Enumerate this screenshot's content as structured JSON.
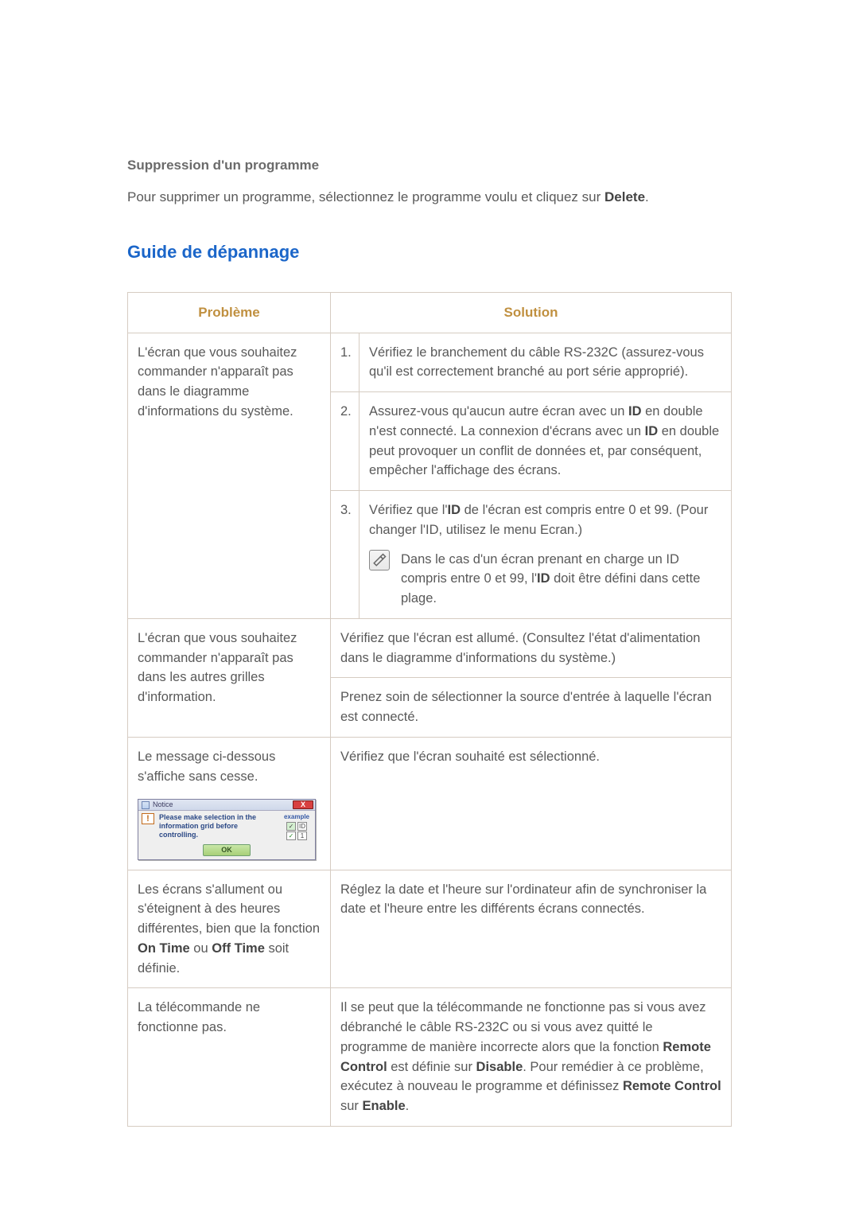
{
  "section": {
    "subheading": "Suppression d'un programme",
    "para_parts": [
      "Pour supprimer un programme, sélectionnez le programme voulu et cliquez sur ",
      "Delete",
      "."
    ]
  },
  "guide_heading": "Guide de dépannage",
  "headers": {
    "problem": "Problème",
    "solution": "Solution"
  },
  "row1": {
    "problem": "L'écran que vous souhaitez commander n'apparaît pas dans le diagramme d'informations du système.",
    "s1_num": "1.",
    "s1_text": "Vérifiez le branchement du câble RS-232C (assurez-vous qu'il est correctement branché au port série approprié).",
    "s2_num": "2.",
    "s2_parts": [
      "Assurez-vous qu'aucun autre écran avec un ",
      "ID",
      " en double n'est connecté. La connexion d'écrans avec un ",
      "ID",
      " en double peut provoquer un conflit de données et, par conséquent, empêcher l'affichage des écrans."
    ],
    "s3_num": "3.",
    "s3_parts": [
      "Vérifiez que l'",
      "ID",
      " de l'écran est compris entre 0 et 99. (Pour changer l'ID, utilisez le menu Ecran.)"
    ],
    "s3_note_parts": [
      "Dans le cas d'un écran prenant en charge un ID compris entre 0 et 99, l'",
      "ID",
      " doit être défini dans cette plage."
    ]
  },
  "row2": {
    "problem": "L'écran que vous souhaitez commander n'apparaît pas dans les autres grilles d'information.",
    "s1": "Vérifiez que l'écran est allumé. (Consultez l'état d'alimentation dans le diagramme d'informations du système.)",
    "s2": "Prenez soin de sélectionner la source d'entrée à laquelle l'écran est connecté."
  },
  "row3": {
    "problem_text": "Le message ci-dessous s'affiche sans cesse.",
    "dialog": {
      "title": "Notice",
      "close": "X",
      "msg": "Please make selection in the information grid before controlling.",
      "example_label": "example",
      "ok": "OK",
      "id_label": "ID",
      "one": "1",
      "check": "✓"
    },
    "solution": "Vérifiez que l'écran souhaité est sélectionné."
  },
  "row4": {
    "problem_parts": [
      "Les écrans s'allument ou s'éteignent à des heures différentes, bien que la fonction ",
      "On Time",
      " ou ",
      "Off Time",
      " soit définie."
    ],
    "solution": "Réglez la date et l'heure sur l'ordinateur afin de synchroniser la date et l'heure entre les différents écrans connectés."
  },
  "row5": {
    "problem": "La télécommande ne fonctionne pas.",
    "solution_parts": [
      "Il se peut que la télécommande ne fonctionne pas si vous avez débranché le câble RS-232C ou si vous avez quitté le programme de manière incorrecte alors que la fonction ",
      "Remote Control",
      " est définie sur ",
      "Disable",
      ". Pour remédier à ce problème, exécutez à nouveau le programme et définissez ",
      "Remote Control",
      " sur ",
      "Enable",
      "."
    ]
  }
}
